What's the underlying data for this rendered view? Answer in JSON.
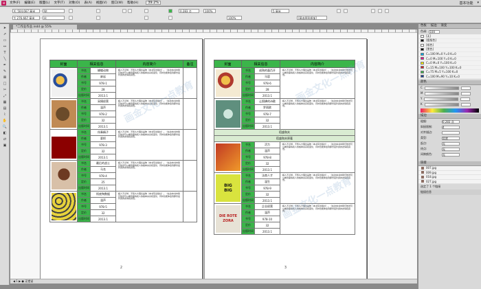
{
  "menubar": {
    "logo": "Id",
    "items": [
      "文件(F)",
      "编辑(E)",
      "版面(L)",
      "文字(T)",
      "对象(O)",
      "表(A)",
      "视图(V)",
      "窗口(W)",
      "帮助(H)"
    ],
    "zoom": "39.2%",
    "right_items": [
      "基本功能",
      "▾"
    ]
  },
  "ctrlbar": {
    "x": "X: 504.667 毫米",
    "y": "Y: 276.667 毫米",
    "w": "W:",
    "h": "H:",
    "stroke": "0.283 点",
    "percent": "100%",
    "frame_fit": "5 毫米",
    "style": "[基本图形框架]",
    "pct2": "100%"
  },
  "document": {
    "tab_title": "*二作业作业.indd @ 55%",
    "status": "◀ 1 ▶  ● 无错误",
    "pages": [
      {
        "number": "2",
        "headers": [
          "封面",
          "相关信息",
          "内容简介",
          "备注"
        ],
        "books": [
          {
            "title": "蝴蝶动物",
            "author": "废岩",
            "isbn": "978-1",
            "price": "28",
            "date": "2013.1"
          },
          {
            "title": "采摘经营",
            "author": "温声",
            "isbn": "978-2",
            "price": "32",
            "date": "2013.1"
          },
          {
            "title": "伴奏精子",
            "author": "夏抓",
            "isbn": "978-3",
            "price": "32",
            "date": "2013.1"
          },
          {
            "title": "最后的战士",
            "author": "马名",
            "isbn": "978-4",
            "price": "25",
            "date": "2013.1"
          },
          {
            "title": "彻底掏数据",
            "author": "温声",
            "isbn": "978-5",
            "price": "32",
            "date": "2013.1"
          }
        ]
      },
      {
        "number": "3",
        "headers": [
          "封面",
          "相关信息",
          "内容简介"
        ],
        "books": [
          {
            "title": "成熟的蛋百开",
            "author": "马容",
            "isbn": "978-6",
            "price": "28",
            "date": "2013.1"
          },
          {
            "title": "让照拂的诗歌",
            "author": "罗雨欧",
            "isbn": "978-7",
            "price": "32",
            "date": "2013.1"
          },
          {
            "title": "活力",
            "author": "温声",
            "isbn": "978-8",
            "price": "32",
            "date": "2013.1"
          },
          {
            "title": "法商人才",
            "author": "温生",
            "isbn": "978-9",
            "price": "32",
            "date": "2013.1"
          },
          {
            "title": "企业经营",
            "author": "温声",
            "isbn": "978-10",
            "price": "32",
            "date": "2013.1"
          }
        ],
        "section_title": "稻盛和夫",
        "section_sub": "稻盛和夫原著",
        "cover_text_big": "BIG\nBIG",
        "cover_text_rote": "DIE ROTE\nZORA"
      }
    ],
    "field_labels": {
      "title": "书名",
      "author": "作者",
      "isbn": "书号",
      "price": "定价",
      "date": "出版时间"
    },
    "desc": "超人不识琴，不知么大理论是物（本书写出版社）。《在这本书中我们依然可以看到事情和人的各种关系和变化，同时也能体会到那份最珍贵的友情和感悟。",
    "watermark": "画金文化一点教育"
  },
  "panel": {
    "tabs": [
      "色板",
      "描边",
      "渐变"
    ],
    "tint": "色调:",
    "tint_val": "100",
    "swatches": [
      {
        "name": "[无]",
        "color": "#ffffff"
      },
      {
        "name": "[套版色]",
        "color": "#000000"
      },
      {
        "name": "[纸色]",
        "color": "#ffffff"
      },
      {
        "name": "[黑色]",
        "color": "#000000"
      },
      {
        "name": "C=100 M=0 Y=0 K=0",
        "color": "#00aeef"
      },
      {
        "name": "C=0 M=100 Y=0 K=0",
        "color": "#ec008c"
      },
      {
        "name": "C=0 M=0 Y=100 K=0",
        "color": "#fff200"
      },
      {
        "name": "C=15 M=100 Y=100 K=0",
        "color": "#d2232a"
      },
      {
        "name": "C=75 M=5 Y=100 K=0",
        "color": "#3bb54a"
      },
      {
        "name": "C=100 M=90 Y=10 K=0",
        "color": "#1b3e94"
      }
    ],
    "color_title": "颜色",
    "color_labels": [
      "C",
      "M",
      "Y",
      "K"
    ],
    "stroke_title": "描边",
    "stroke_rows": [
      {
        "label": "粗细:",
        "value": "0.283 点"
      },
      {
        "label": "斜接限制:",
        "value": "4"
      },
      {
        "label": "对齐描边:",
        "value": ""
      },
      {
        "label": "类型:",
        "value": "实底"
      },
      {
        "label": "起点:",
        "value": "无"
      },
      {
        "label": "终点:",
        "value": "无"
      },
      {
        "label": "间隙颜色:",
        "value": "无"
      }
    ],
    "links_title": "链接",
    "links": [
      "007.jpg",
      "009.jpg",
      "018.jpg",
      "027.jpg"
    ],
    "links_footer": "选定了 1 个链接",
    "link_info": "链接信息"
  }
}
